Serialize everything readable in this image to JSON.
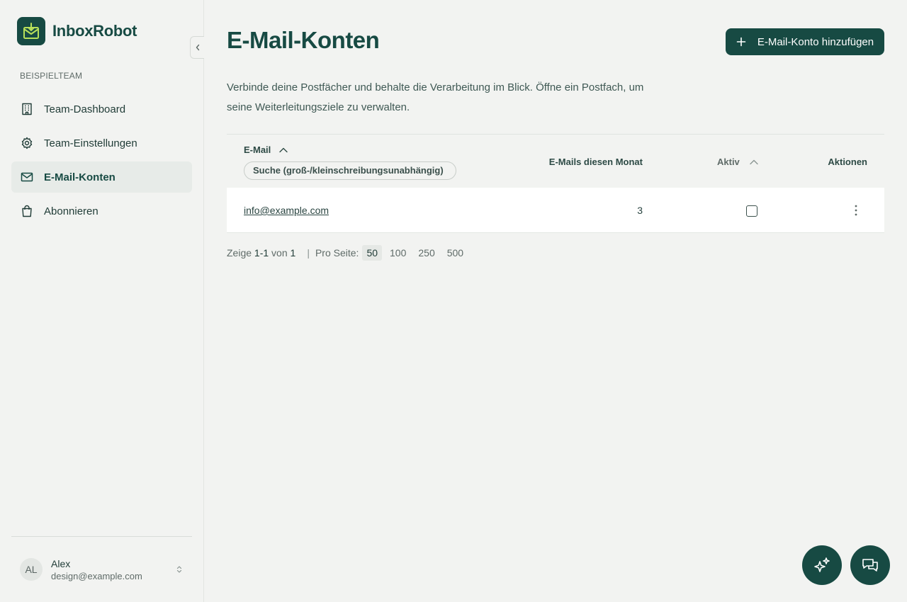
{
  "app": {
    "name": "InboxRobot"
  },
  "sidebar": {
    "team_label": "BEISPIELTEAM",
    "items": [
      {
        "label": "Team-Dashboard",
        "icon": "building-icon",
        "active": false
      },
      {
        "label": "Team-Einstellungen",
        "icon": "gear-icon",
        "active": false
      },
      {
        "label": "E-Mail-Konten",
        "icon": "mail-icon",
        "active": true
      },
      {
        "label": "Abonnieren",
        "icon": "shopping-bag-icon",
        "active": false
      }
    ],
    "user": {
      "initials": "AL",
      "name": "Alex",
      "email": "design@example.com"
    }
  },
  "main": {
    "title": "E-Mail-Konten",
    "add_button": "E-Mail-Konto hinzufügen",
    "description": "Verbinde deine Postfächer und behalte die Verarbeitung im Blick. Öffne ein Postfach, um seine Weiterleitungsziele zu verwalten."
  },
  "table": {
    "columns": {
      "email": "E-Mail",
      "emails_this_month": "E-Mails diesen Monat",
      "active": "Aktiv",
      "actions": "Aktionen"
    },
    "search_placeholder": "Suche (groß-/kleinschreibungsunabhängig)",
    "rows": [
      {
        "email": "info@example.com",
        "emails_this_month": "3",
        "active": false
      }
    ]
  },
  "pagination": {
    "showing_prefix": "Zeige",
    "range": "1-1",
    "of_label": "von",
    "total": "1",
    "separator": "|",
    "per_page_label": "Pro Seite:",
    "options": [
      "50",
      "100",
      "250",
      "500"
    ],
    "selected": "50"
  },
  "colors": {
    "brand": "#174a43",
    "background": "#f2f3f1",
    "active_nav": "#e7ebe8"
  }
}
